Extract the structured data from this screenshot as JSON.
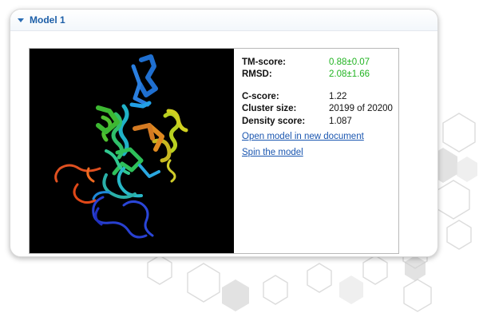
{
  "panel": {
    "title": "Model 1"
  },
  "viewer": {
    "image_description_name": "protein-structure-render"
  },
  "metrics": {
    "tm_score_label": "TM-score:",
    "tm_score_value": "0.88±0.07",
    "rmsd_label": "RMSD:",
    "rmsd_value": "2.08±1.66",
    "c_score_label": "C-score:",
    "c_score_value": "1.22",
    "cluster_size_label": "Cluster size:",
    "cluster_size_value": "20199 of 20200",
    "density_score_label": "Density score:",
    "density_score_value": "1.087"
  },
  "links": {
    "open_model": "Open model in new document",
    "spin_model": "Spin the model"
  },
  "colors": {
    "accent": "#1d5fa8",
    "green_value": "#22b422",
    "link": "#1a56b0"
  }
}
